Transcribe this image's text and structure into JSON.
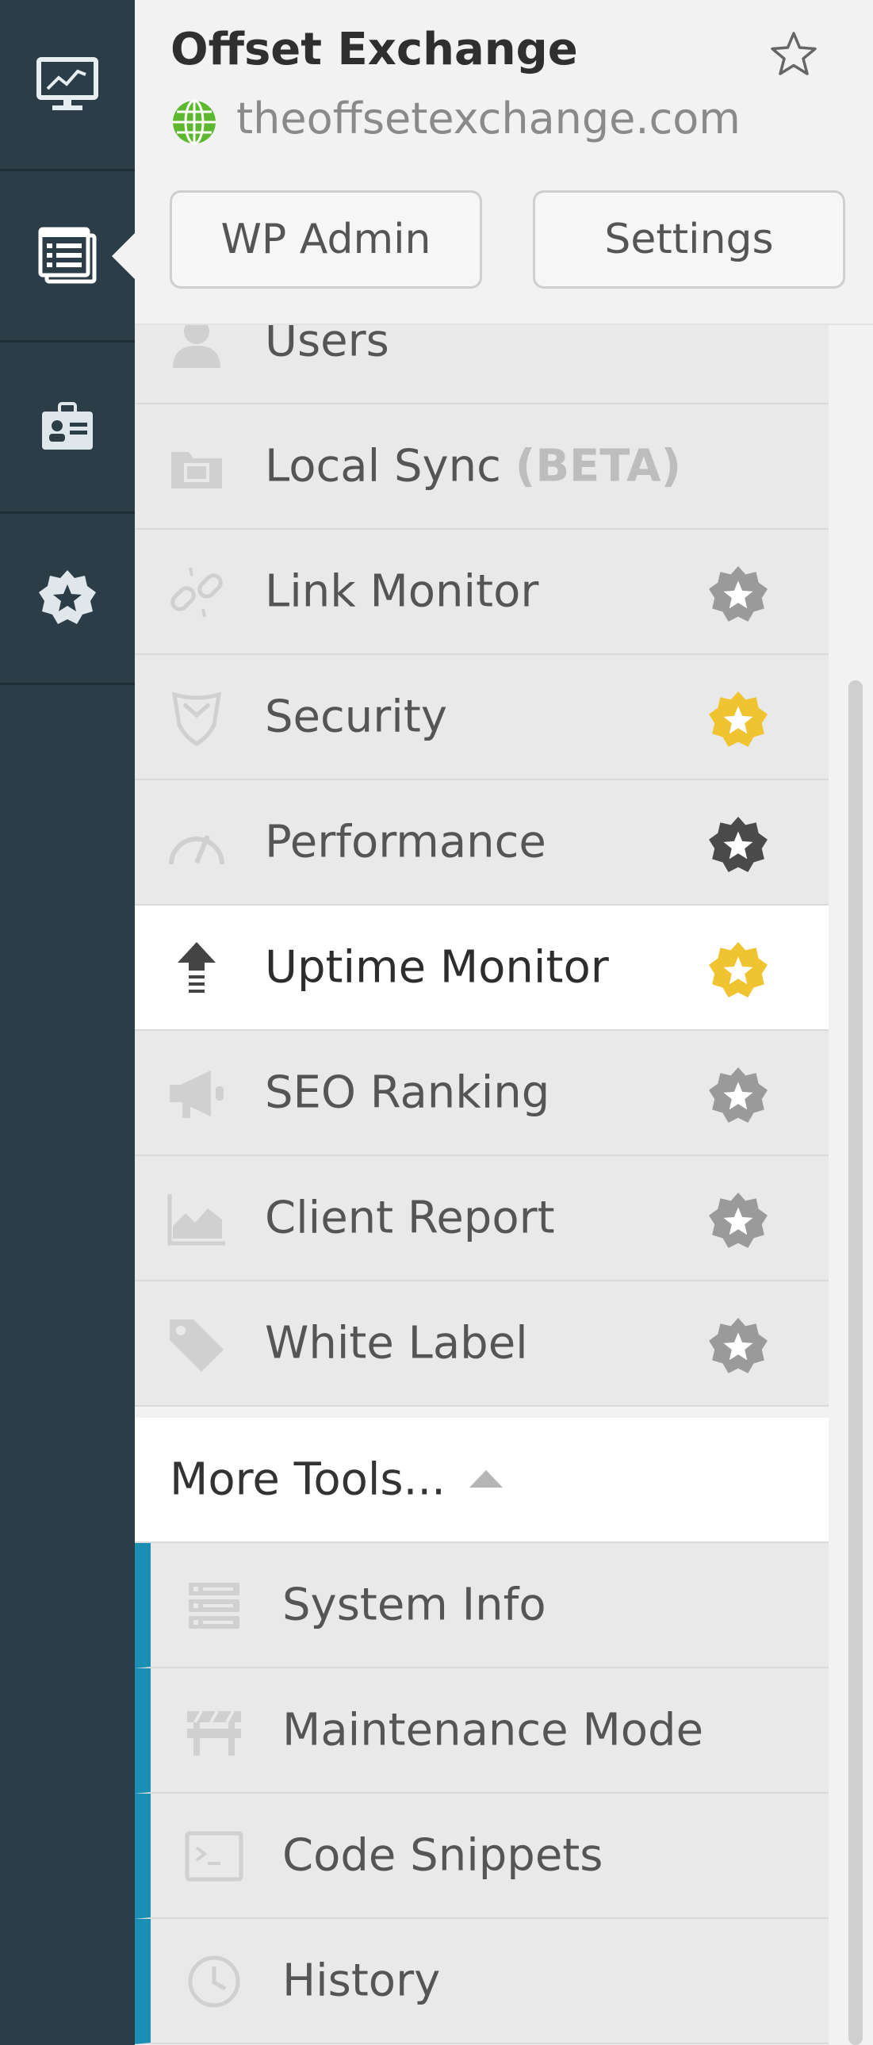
{
  "header": {
    "title": "Offset Exchange",
    "url": "theoffsetexchange.com",
    "wp_admin_label": "WP Admin",
    "settings_label": "Settings"
  },
  "rail": {
    "items": [
      {
        "icon": "monitor-chart-icon"
      },
      {
        "icon": "list-stack-icon",
        "selected": true
      },
      {
        "icon": "id-badge-icon"
      },
      {
        "icon": "star-badge-icon"
      }
    ]
  },
  "menu": {
    "items": [
      {
        "label": "Users",
        "icon": "user-icon"
      },
      {
        "label": "Local Sync",
        "beta": "(BETA)",
        "icon": "folder-sync-icon"
      },
      {
        "label": "Link Monitor",
        "icon": "broken-link-icon",
        "badge": "grey"
      },
      {
        "label": "Security",
        "icon": "shield-icon",
        "badge": "gold"
      },
      {
        "label": "Performance",
        "icon": "gauge-icon",
        "badge": "dark"
      },
      {
        "label": "Uptime Monitor",
        "icon": "upload-arrow-icon",
        "badge": "gold",
        "active": true
      },
      {
        "label": "SEO Ranking",
        "icon": "megaphone-icon",
        "badge": "grey"
      },
      {
        "label": "Client Report",
        "icon": "area-chart-icon",
        "badge": "grey"
      },
      {
        "label": "White Label",
        "icon": "tag-icon",
        "badge": "grey"
      }
    ],
    "more_tools_label": "More Tools...",
    "sub_items": [
      {
        "label": "System Info",
        "icon": "server-icon"
      },
      {
        "label": "Maintenance Mode",
        "icon": "barrier-icon"
      },
      {
        "label": "Code Snippets",
        "icon": "terminal-icon"
      },
      {
        "label": "History",
        "icon": "clock-icon"
      }
    ]
  },
  "colors": {
    "rail": "#2b3e48",
    "badge_gold": "#f0c330",
    "badge_grey": "#9a9a9a",
    "badge_dark": "#4a4a4a",
    "accent_bar": "#1a8fb3",
    "globe": "#5cb82e"
  }
}
